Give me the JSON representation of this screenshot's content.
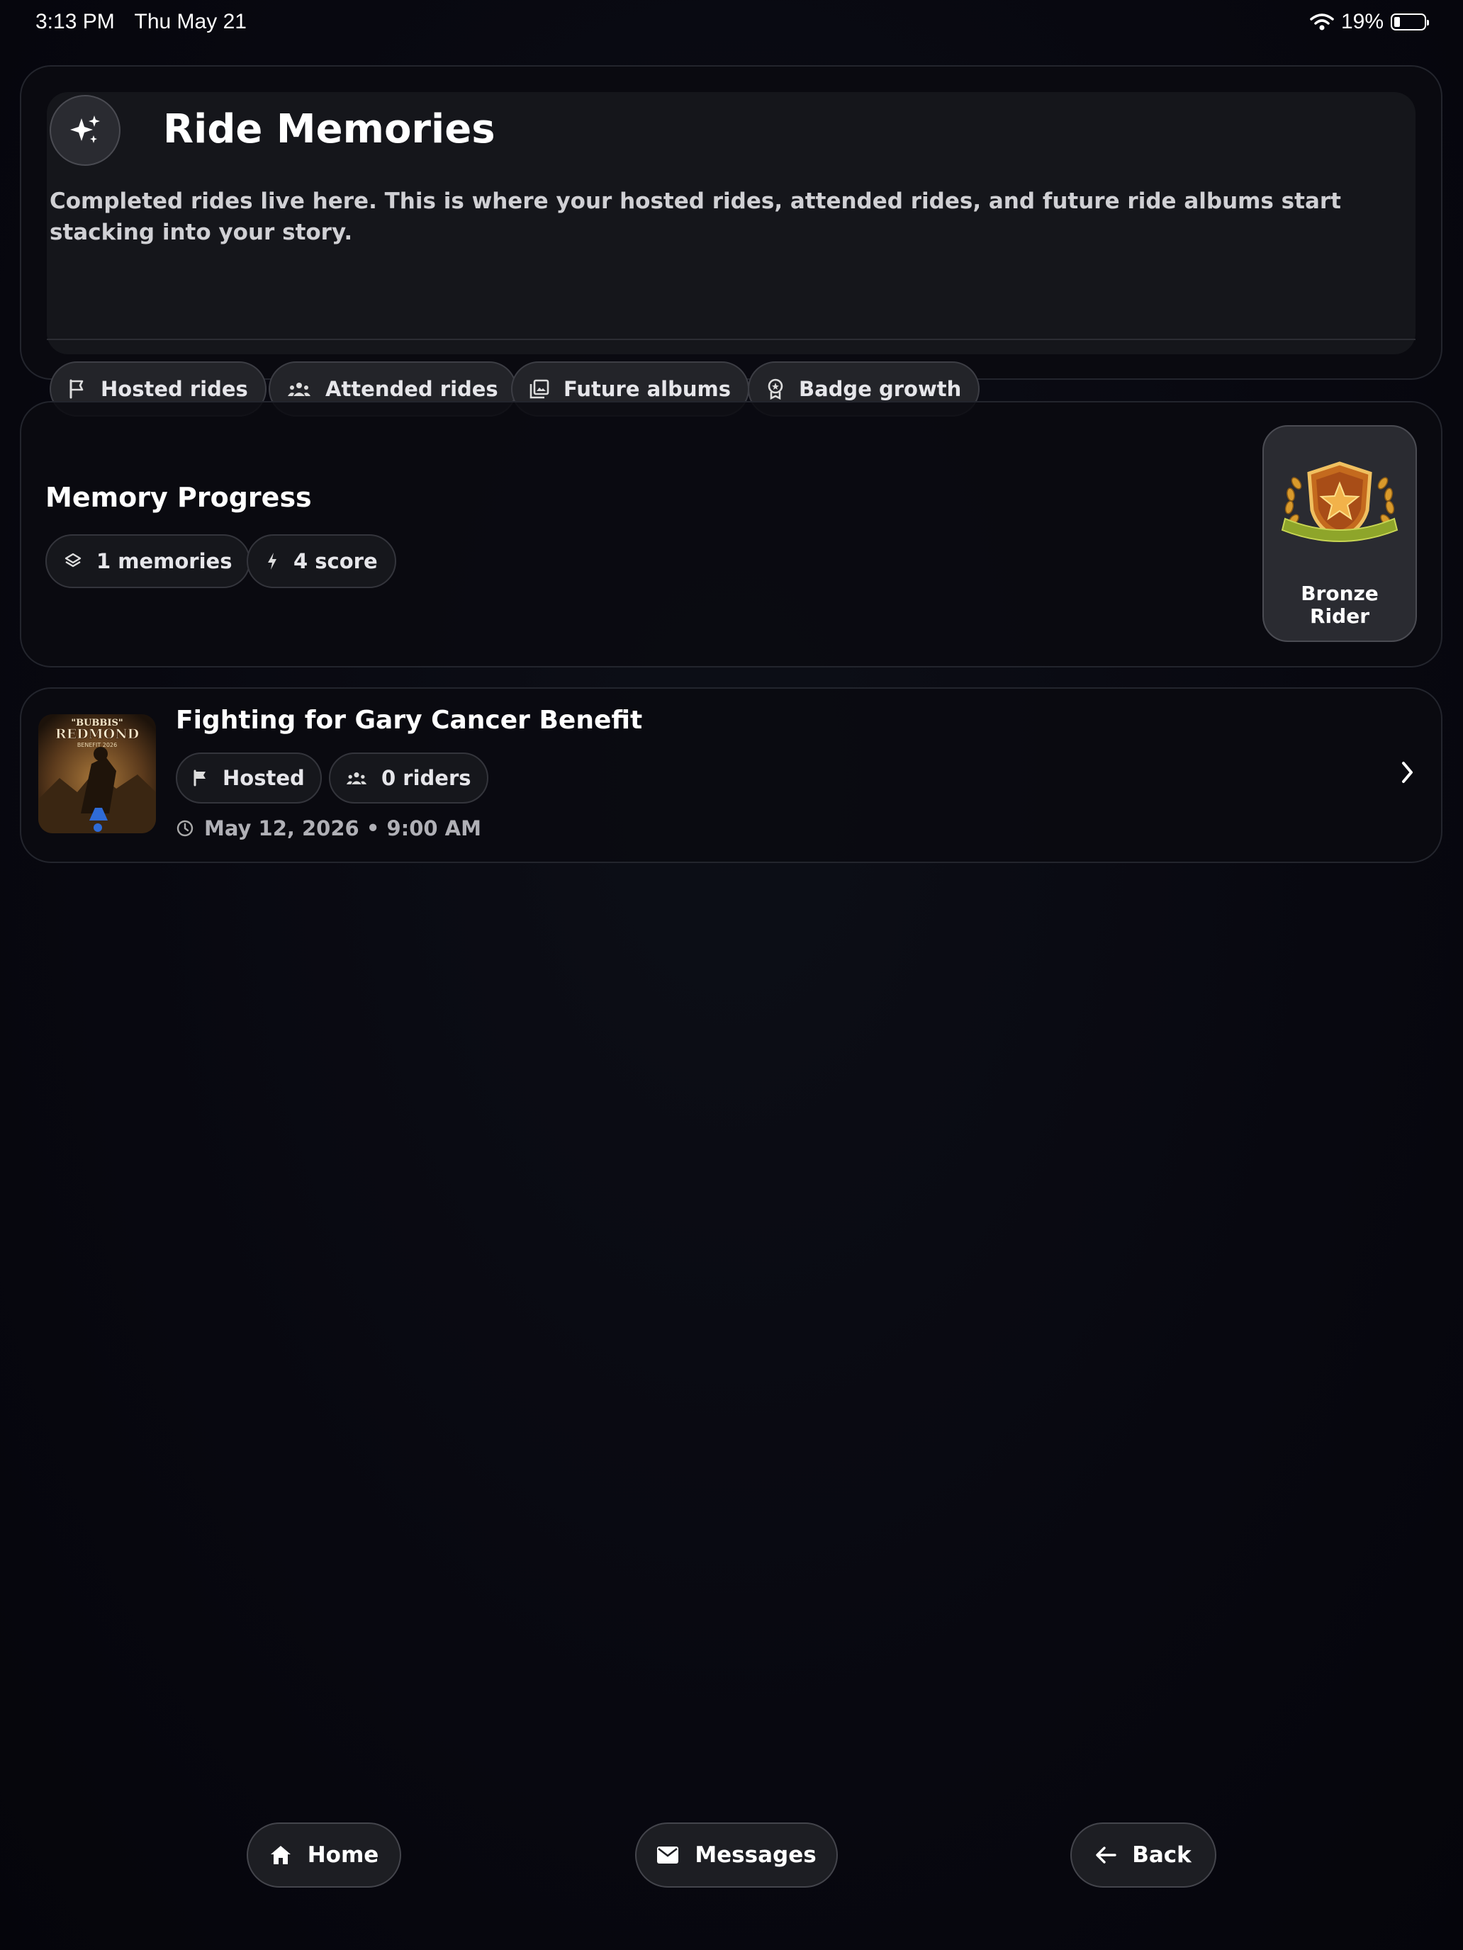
{
  "status_bar": {
    "time": "3:13 PM",
    "date": "Thu May 21",
    "battery": "19%"
  },
  "hero": {
    "icon": "sparkles-icon",
    "title": "Ride Memories",
    "description": "Completed rides live here. This is where your hosted rides, attended rides, and future ride albums start stacking into your story.",
    "tags": [
      {
        "label": "Hosted rides",
        "icon": "flag-icon"
      },
      {
        "label": "Attended rides",
        "icon": "group-icon"
      },
      {
        "label": "Future albums",
        "icon": "album-icon"
      },
      {
        "label": "Badge growth",
        "icon": "medal-icon"
      }
    ]
  },
  "progress": {
    "title": "Memory Progress",
    "memories": "1 memories",
    "score": "4 score",
    "badge": {
      "line1": "Bronze",
      "line2": "Rider",
      "icon": "bronze-badge-icon"
    }
  },
  "rides": [
    {
      "title": "Fighting for Gary Cancer Benefit",
      "role": "Hosted",
      "riders": "0 riders",
      "datetime": "May 12, 2026 • 9:00 AM",
      "thumb_line1": "\"BUBBIS\"",
      "thumb_line2": "REDMOND",
      "thumb_line3": "BENEFIT 2026"
    }
  ],
  "nav": {
    "home": "Home",
    "messages": "Messages",
    "back": "Back"
  },
  "colors": {
    "background": "#07080e",
    "card_border": "#23252d",
    "chip_bg": "#232429",
    "badge_gold": "#d99a2b"
  }
}
